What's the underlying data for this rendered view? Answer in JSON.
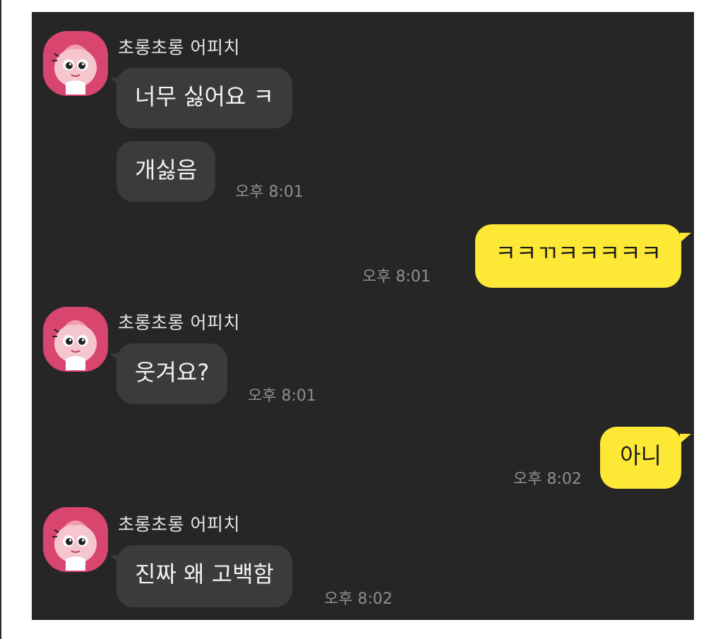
{
  "colors": {
    "background": "#262626",
    "incoming_bubble": "#3b3b3b",
    "outgoing_bubble": "#fde835",
    "avatar": "#d8456f",
    "timestamp": "#8f8f8f"
  },
  "avatar_icon": "apeach-character-icon",
  "groups": [
    {
      "sender": "초롱초롱 어피치",
      "messages": [
        {
          "text": "너무 싫어요 ㅋ"
        },
        {
          "text": "개싫음",
          "time": "오후 8:01"
        }
      ]
    },
    {
      "outgoing": true,
      "messages": [
        {
          "text": "ㅋㅋㄲㅋㅋㅋㅋㅋ",
          "time": "오후 8:01"
        }
      ]
    },
    {
      "sender": "초롱초롱 어피치",
      "messages": [
        {
          "text": "웃겨요?",
          "time": "오후 8:01"
        }
      ]
    },
    {
      "outgoing": true,
      "messages": [
        {
          "text": "아니",
          "time": "오후 8:02"
        }
      ]
    },
    {
      "sender": "초롱초롱 어피치",
      "messages": [
        {
          "text": "진짜 왜 고백함",
          "time": "오후 8:02"
        }
      ]
    }
  ]
}
